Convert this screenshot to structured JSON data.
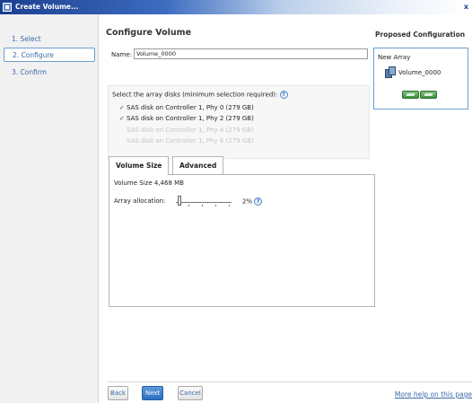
{
  "window": {
    "title": "Create Volume..."
  },
  "nav": {
    "items": [
      "1. Select",
      "2. Configure",
      "3. Confirm"
    ],
    "active_index": 1
  },
  "page": {
    "title": "Configure Volume"
  },
  "name_field": {
    "label": "Name:",
    "value": "Volume_0000"
  },
  "disks": {
    "prompt": "Select the array disks (minimum selection required):",
    "items": [
      {
        "label": "SAS disk on Controller 1, Phy 0 (279 GB)",
        "checked": true,
        "enabled": true
      },
      {
        "label": "SAS disk on Controller 1, Phy 2 (279 GB)",
        "checked": true,
        "enabled": true
      },
      {
        "label": "SAS disk on Controller 1, Phy 4 (279 GB)",
        "checked": false,
        "enabled": false
      },
      {
        "label": "SAS disk on Controller 1, Phy 6 (279 GB)",
        "checked": false,
        "enabled": false
      }
    ]
  },
  "tabs": {
    "volume_size": "Volume Size",
    "advanced": "Advanced"
  },
  "volume_size": {
    "size_text": "Volume Size 4,468 MB",
    "allocation_label": "Array allocation:",
    "allocation_percent": 2,
    "allocation_text": "2%"
  },
  "proposed": {
    "title": "Proposed Configuration",
    "array_label": "New Array",
    "volume_name": "Volume_0000"
  },
  "buttons": {
    "back": "Back",
    "next": "Next",
    "cancel": "Cancel"
  },
  "help_link": "More help on this page",
  "icons": {
    "app": "app-window-icon",
    "close": "close-icon",
    "help": "question-mark-icon",
    "volume": "volume-stack-icon",
    "disk": "disk-icon"
  }
}
